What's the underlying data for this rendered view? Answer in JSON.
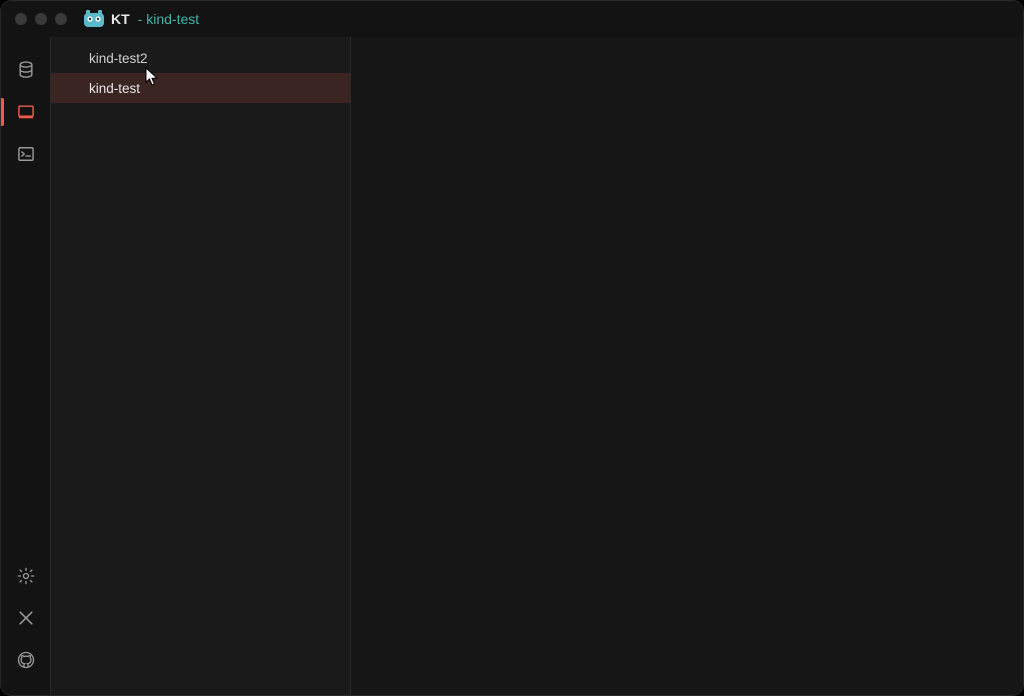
{
  "title": {
    "app_name": "KT",
    "suffix": " - kind-test"
  },
  "activity": {
    "items": [
      "database",
      "cluster",
      "terminal"
    ],
    "footer": [
      "settings",
      "x-social",
      "github"
    ],
    "active_index": 1
  },
  "sidebar": {
    "items": [
      {
        "label": "kind-test2",
        "selected": false
      },
      {
        "label": "kind-test",
        "selected": true
      }
    ]
  }
}
